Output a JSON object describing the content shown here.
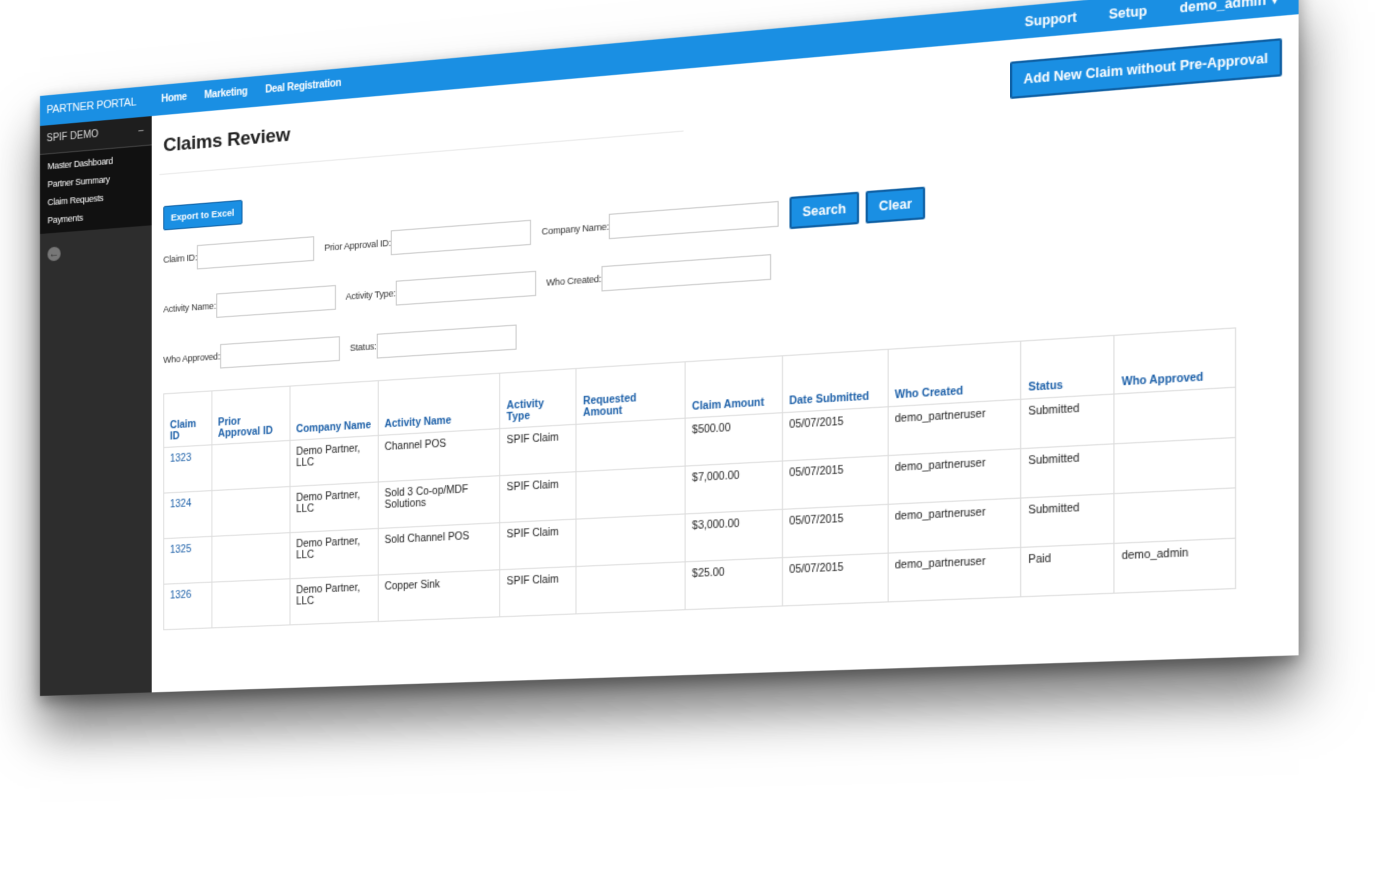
{
  "sidebar": {
    "brand": "PARTNER PORTAL",
    "section_title": "SPIF DEMO",
    "collapse_symbol": "−",
    "items": [
      {
        "label": "Master Dashboard"
      },
      {
        "label": "Partner Summary"
      },
      {
        "label": "Claim Requests"
      },
      {
        "label": "Payments"
      }
    ],
    "back_icon": "←"
  },
  "topnav": {
    "links": [
      {
        "label": "Home"
      },
      {
        "label": "Marketing"
      },
      {
        "label": "Deal Registration"
      }
    ],
    "support": "Support",
    "setup": "Setup",
    "user": "demo_admin",
    "caret": "▾"
  },
  "header": {
    "add_claim_label": "Add New Claim without Pre-Approval",
    "page_title": "Claims Review",
    "export_label": "Export to Excel"
  },
  "filters": {
    "claim_id": "Claim ID:",
    "prior_approval_id": "Prior Approval ID:",
    "company_name": "Company Name:",
    "activity_name": "Activity Name:",
    "activity_type": "Activity Type:",
    "who_created": "Who Created:",
    "who_approved": "Who Approved:",
    "status": "Status:",
    "search_label": "Search",
    "clear_label": "Clear"
  },
  "table": {
    "headers": {
      "claim_id": "Claim ID",
      "prior_approval_id": "Prior Approval ID",
      "company_name": "Company Name",
      "activity_name": "Activity Name",
      "activity_type": "Activity Type",
      "requested_amount": "Requested Amount",
      "claim_amount": "Claim Amount",
      "date_submitted": "Date Submitted",
      "who_created": "Who Created",
      "status": "Status",
      "who_approved": "Who Approved"
    },
    "rows": [
      {
        "claim_id": "1323",
        "prior_approval_id": "",
        "company_name": "Demo Partner, LLC",
        "activity_name": "Channel POS",
        "activity_type": "SPIF Claim",
        "requested_amount": "",
        "claim_amount": "$500.00",
        "date_submitted": "05/07/2015",
        "who_created": "demo_partneruser",
        "status": "Submitted",
        "who_approved": ""
      },
      {
        "claim_id": "1324",
        "prior_approval_id": "",
        "company_name": "Demo Partner, LLC",
        "activity_name": "Sold 3 Co-op/MDF Solutions",
        "activity_type": "SPIF Claim",
        "requested_amount": "",
        "claim_amount": "$7,000.00",
        "date_submitted": "05/07/2015",
        "who_created": "demo_partneruser",
        "status": "Submitted",
        "who_approved": ""
      },
      {
        "claim_id": "1325",
        "prior_approval_id": "",
        "company_name": "Demo Partner, LLC",
        "activity_name": "Sold Channel POS",
        "activity_type": "SPIF Claim",
        "requested_amount": "",
        "claim_amount": "$3,000.00",
        "date_submitted": "05/07/2015",
        "who_created": "demo_partneruser",
        "status": "Submitted",
        "who_approved": ""
      },
      {
        "claim_id": "1326",
        "prior_approval_id": "",
        "company_name": "Demo Partner, LLC",
        "activity_name": "Copper Sink",
        "activity_type": "SPIF Claim",
        "requested_amount": "",
        "claim_amount": "$25.00",
        "date_submitted": "05/07/2015",
        "who_created": "demo_partneruser",
        "status": "Paid",
        "who_approved": "demo_admin"
      }
    ]
  }
}
